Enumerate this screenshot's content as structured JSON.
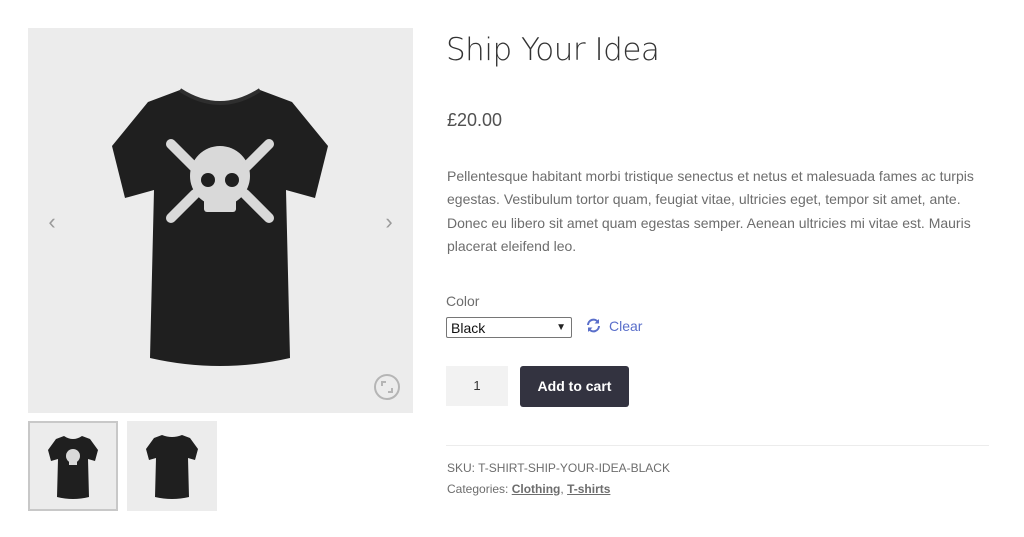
{
  "product": {
    "title": "Ship Your Idea",
    "price": "£20.00",
    "description": "Pellentesque habitant morbi tristique senectus et netus et malesuada fames ac turpis egestas. Vestibulum tortor quam, feugiat vitae, ultricies eget, tempor sit amet, ante. Donec eu libero sit amet quam egestas semper. Aenean ultricies mi vitae est. Mauris placerat eleifend leo."
  },
  "gallery": {
    "prev_icon": "chevron-left-icon",
    "next_icon": "chevron-right-icon",
    "zoom_icon": "zoom-icon",
    "prev_glyph": "‹",
    "next_glyph": "›"
  },
  "variation": {
    "label": "Color",
    "selected": "Black",
    "clear_label": "Clear",
    "clear_icon": "refresh-icon"
  },
  "cart": {
    "quantity": "1",
    "add_label": "Add to cart"
  },
  "meta": {
    "sku_label": "SKU:",
    "sku": "T-SHIRT-SHIP-YOUR-IDEA-BLACK",
    "categories_label": "Categories:",
    "categories": [
      "Clothing",
      "T-shirts"
    ],
    "separator": ","
  },
  "colors": {
    "button_bg": "#333340",
    "link": "#5a6fca",
    "gallery_bg": "#ececec",
    "shirt": "#1f1f1f"
  }
}
